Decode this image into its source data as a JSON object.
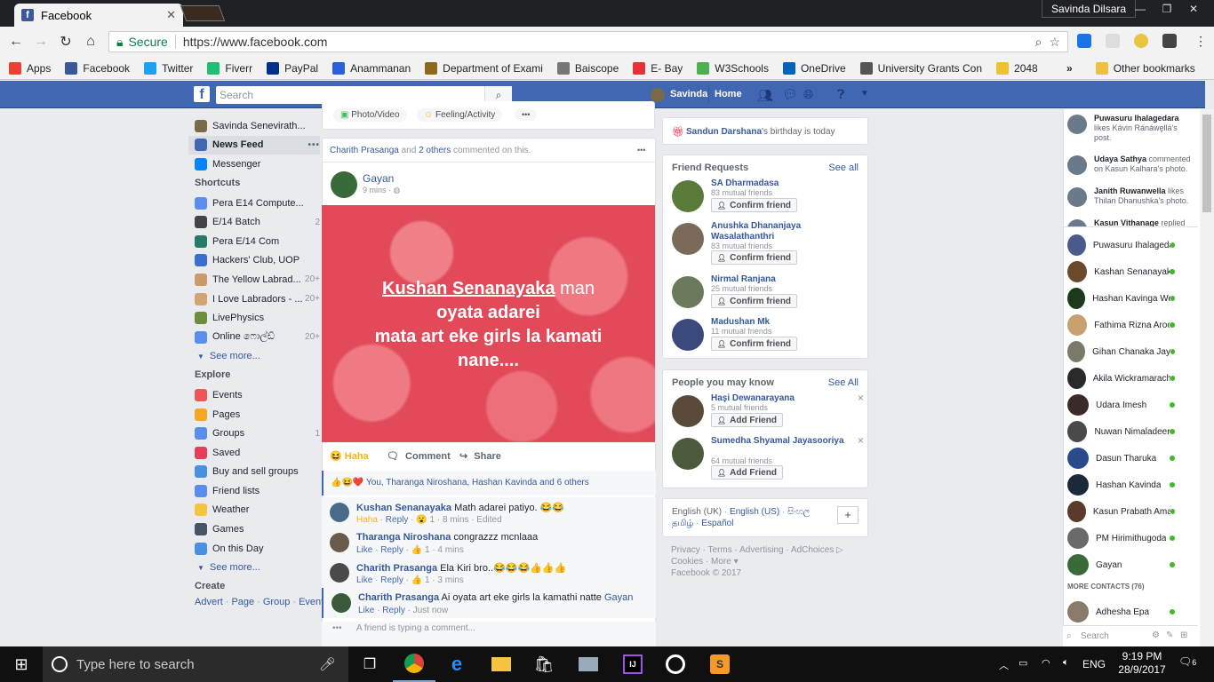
{
  "browser": {
    "tab_title": "Facebook",
    "profile": "Savinda Dilsara",
    "secure_label": "Secure",
    "url": "https://www.facebook.com"
  },
  "bookmarks": [
    {
      "label": "Apps",
      "color": "#e94235"
    },
    {
      "label": "Facebook",
      "color": "#3b5998"
    },
    {
      "label": "Twitter",
      "color": "#1da1f2"
    },
    {
      "label": "Fiverr",
      "color": "#1dbf73"
    },
    {
      "label": "PayPal",
      "color": "#003087"
    },
    {
      "label": "Anammanan",
      "color": "#2b5fd9"
    },
    {
      "label": "Department of Exami",
      "color": "#8b6a1f"
    },
    {
      "label": "Baiscope",
      "color": "#777777"
    },
    {
      "label": "E- Bay",
      "color": "#e53238"
    },
    {
      "label": "W3Schools",
      "color": "#4caf50"
    },
    {
      "label": "OneDrive",
      "color": "#0364b8"
    },
    {
      "label": "University Grants Con",
      "color": "#555555"
    },
    {
      "label": "2048",
      "color": "#edc22e"
    }
  ],
  "bookmarks_more": "»",
  "other_bookmarks": "Other bookmarks",
  "fbbar": {
    "search_placeholder": "Search",
    "user": "Savinda",
    "home": "Home"
  },
  "left": {
    "profile": "Savinda Senevirath...",
    "top": [
      {
        "label": "News Feed",
        "color": "#4267b2"
      },
      {
        "label": "Messenger",
        "color": "#0084ff"
      }
    ],
    "shortcuts_title": "Shortcuts",
    "shortcuts": [
      {
        "label": "Pera E14 Compute...",
        "count": "",
        "color": "#5b8def"
      },
      {
        "label": "E/14 Batch",
        "count": "2",
        "color": "#444444"
      },
      {
        "label": "Pera E/14 Com",
        "count": "",
        "color": "#2a7a6a"
      },
      {
        "label": "Hackers' Club, UOP",
        "count": "",
        "color": "#3b6fcf"
      },
      {
        "label": "The Yellow Labrad...",
        "count": "20+",
        "color": "#c99a6a"
      },
      {
        "label": "I Love Labradors - ...",
        "count": "20+",
        "color": "#d4a373"
      },
      {
        "label": "LivePhysics",
        "count": "",
        "color": "#6a8e3a"
      },
      {
        "label": "Online ෆොල්ඩ්",
        "count": "20+",
        "color": "#5b8def"
      }
    ],
    "see_more": "See more...",
    "explore_title": "Explore",
    "explore": [
      {
        "label": "Events",
        "count": "",
        "color": "#f05454"
      },
      {
        "label": "Pages",
        "count": "",
        "color": "#f5a623"
      },
      {
        "label": "Groups",
        "count": "1",
        "color": "#5b8def"
      },
      {
        "label": "Saved",
        "count": "",
        "color": "#e53e5b"
      },
      {
        "label": "Buy and sell groups",
        "count": "",
        "color": "#4a90e2"
      },
      {
        "label": "Friend lists",
        "count": "",
        "color": "#5b8def"
      },
      {
        "label": "Weather",
        "count": "",
        "color": "#f5c542"
      },
      {
        "label": "Games",
        "count": "",
        "color": "#445566"
      },
      {
        "label": "On this Day",
        "count": "",
        "color": "#4a90e2"
      }
    ],
    "see_more2": "See more...",
    "create_title": "Create",
    "create_links": [
      "Advert",
      "Page",
      "Group",
      "Event"
    ],
    "dot_sep": "·"
  },
  "composer": {
    "photo": "Photo/Video",
    "feeling": "Feeling/Activity",
    "more": "•••"
  },
  "post": {
    "activity_name": "Charith Prasanga",
    "activity_and": "and",
    "activity_others": "2 others",
    "activity_suffix": "commented on this.",
    "menu": "•••",
    "author": "Gayan",
    "time": "9 mins · ◍",
    "text_name": "Kushan Senanayaka",
    "text_rest1": " man",
    "text_line2": "oyata adarei",
    "text_line3": "mata art eke girls la kamati",
    "text_line4": "nane....",
    "actions": {
      "haha": "Haha",
      "comment": "Comment",
      "share": "Share"
    },
    "reactions": "You, Tharanga Niroshana, Hashan Kavinda and 6 others",
    "comments": [
      {
        "name": "Kushan Senanayaka",
        "text": "Math adarei patiyo. 😂😂",
        "meta": [
          "Haha",
          "Reply",
          "😮 1",
          "8 mins",
          "Edited"
        ]
      },
      {
        "name": "Tharanga Niroshana",
        "text": "congrazzz mcnlaaa",
        "meta": [
          "Like",
          "Reply",
          "👍 1",
          "4 mins"
        ]
      },
      {
        "name": "Charith Prasanga",
        "text": "Ela Kiri bro..😂😂😂👍👍👍",
        "meta": [
          "Like",
          "Reply",
          "👍 1",
          "3 mins"
        ]
      },
      {
        "name": "Charith Prasanga",
        "text": "Ai oyata art eke girls la kamathi natte ",
        "tag": "Gayan",
        "meta": [
          "Like",
          "Reply",
          "Just now"
        ]
      }
    ],
    "typing": "A friend is typing a comment..."
  },
  "right": {
    "birthday_name": "Sandun Darshana",
    "birthday_suffix": "'s birthday is today",
    "fr_title": "Friend Requests",
    "fr_see": "See all",
    "confirm": "Confirm friend",
    "friend_requests": [
      {
        "name": "SA Dharmadasa",
        "mutual": "83 mutual friends",
        "color": "#5a7a3a"
      },
      {
        "name": "Anushka Dhananjaya Wasalathanthri",
        "mutual": "83 mutual friends",
        "color": "#7a6a5a"
      },
      {
        "name": "Nirmal Ranjana",
        "mutual": "25 mutual friends",
        "color": "#6a7a5a"
      },
      {
        "name": "Madushan Mk",
        "mutual": "11 mutual friends",
        "color": "#3a4a7a"
      }
    ],
    "pymk_title": "People you may know",
    "pymk_see": "See All",
    "add": "Add Friend",
    "close": "×",
    "pymk": [
      {
        "name": "Haşi Dewanarayana",
        "mutual": "5 mutual friends",
        "color": "#5a4a3a"
      },
      {
        "name": "Sumedha Shyamal Jayasooriya",
        "mutual": "64 mutual friends",
        "color": "#4a5a3a"
      }
    ],
    "langs": [
      "English (UK)",
      "English (US)",
      "සිංහල",
      "தமிழ்",
      "Español"
    ],
    "plus": "+",
    "footer1": [
      "Privacy",
      "Terms",
      "Advertising",
      "AdChoices ▷"
    ],
    "footer2": [
      "Cookies",
      "More ▾"
    ],
    "copyright": "Facebook © 2017"
  },
  "ticker": [
    {
      "name": "Puwasuru Ihalagedara",
      "text": " likes Kávin Ránáwęllá's post."
    },
    {
      "name": "Udaya Sathya",
      "text": " commented on Kasun Kalhara's photo."
    },
    {
      "name": "Janith Ruwanwella",
      "text": " likes Thilan Dhanushka's photo."
    },
    {
      "name": "Kasun Vithanage",
      "text": " replied"
    }
  ],
  "contacts": [
    {
      "name": "Puwasuru Ihalagedara",
      "color": "#4a5a8a"
    },
    {
      "name": "Kashan Senanayaka",
      "color": "#6a4a2a"
    },
    {
      "name": "Hashan Kavinga Wee...",
      "color": "#1a3a1a"
    },
    {
      "name": "Fathima Rizna Arooz",
      "color": "#c8a070"
    },
    {
      "name": "Gihan Chanaka Jayat...",
      "color": "#7a7a6a"
    },
    {
      "name": "Akila Wickramarachchi",
      "color": "#2a2a2a"
    },
    {
      "name": "Udara Imesh",
      "color": "#3a2a2a"
    },
    {
      "name": "Nuwan Nimaladeera",
      "color": "#4a4a4a"
    },
    {
      "name": "Dasun Tharuka",
      "color": "#2a4a8a"
    },
    {
      "name": "Hashan Kavinda",
      "color": "#1a2a3a"
    },
    {
      "name": "Kasun Prabath Amar...",
      "color": "#5a3a2a"
    },
    {
      "name": "PM Hirimithugoda",
      "color": "#6a6a6a"
    },
    {
      "name": "Gayan",
      "color": "#3a6a3a"
    }
  ],
  "more_contacts": "MORE CONTACTS (76)",
  "last_contact": "Adhesha Epa",
  "chat_search": "Search",
  "taskbar": {
    "search": "Type here to search",
    "lang": "ENG",
    "time": "9:19 PM",
    "date": "28/9/2017",
    "notif": "6"
  }
}
